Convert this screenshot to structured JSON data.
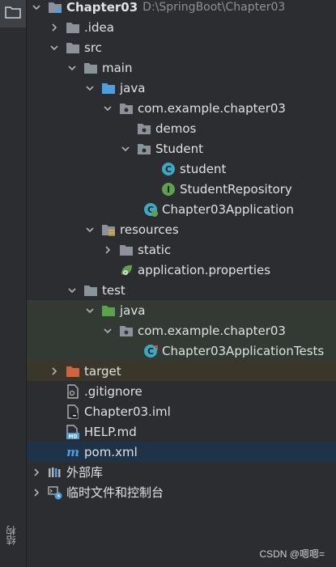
{
  "side_panel": {
    "structure_label": "结构"
  },
  "tree": {
    "root": {
      "label": "Chapter03",
      "path": "D:\\SpringBoot\\Chapter03"
    },
    "idea": "idea",
    "idea_prefix": ".",
    "src": "src",
    "main": "main",
    "main_java": "java",
    "main_package": "com.example.chapter03",
    "demos": "demos",
    "student_pkg": "Student",
    "student_class": "student",
    "student_repo": "StudentRepository",
    "app_class": "Chapter03Application",
    "resources": "resources",
    "static": "static",
    "app_properties": "application.properties",
    "test": "test",
    "test_java": "java",
    "test_package": "com.example.chapter03",
    "tests_class": "Chapter03ApplicationTests",
    "target": "target",
    "gitignore": ".gitignore",
    "iml": "Chapter03.iml",
    "help": "HELP.md",
    "pom": "pom.xml",
    "external_libs": "外部库",
    "scratches": "临时文件和控制台"
  },
  "watermark": "CSDN @嗯嗯=",
  "colors": {
    "background": "#2b2d30",
    "selected_row": "#1e3347",
    "test_highlight": "#323a33",
    "excluded_highlight": "#3a3629",
    "folder": "#8c929b",
    "source_folder": "#4e9fe0",
    "test_folder": "#5aa34b",
    "target_folder": "#d0643c",
    "class_icon": "#3da7c4",
    "interface_icon": "#5fa04e"
  }
}
